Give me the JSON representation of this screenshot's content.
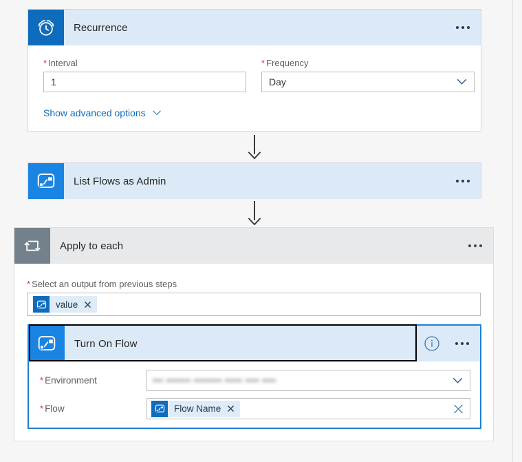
{
  "theme": {
    "accent_blue": "#0f6cbd",
    "icon_blue": "#1a84e3",
    "header_blue": "#dceaf7",
    "header_gray": "#e8e9ea",
    "icon_gray": "#74808c",
    "selected_border": "#1c7fd6",
    "required_red": "#d13438",
    "page_background": "#f6f6f6"
  },
  "steps": {
    "recurrence": {
      "title": "Recurrence",
      "icon": "alarm-clock-icon",
      "menu": "ellipsis-icon",
      "interval": {
        "label": "Interval",
        "required": true,
        "value": "1"
      },
      "frequency": {
        "label": "Frequency",
        "required": true,
        "value": "Day",
        "chevron": "chevron-down-icon"
      },
      "advanced_link": {
        "label": "Show advanced options",
        "chevron": "chevron-down-icon"
      }
    },
    "list_flows": {
      "title": "List Flows as Admin",
      "icon": "power-automate-flow-icon",
      "menu": "ellipsis-icon"
    },
    "apply_to_each": {
      "title": "Apply to each",
      "icon": "loop-repeat-icon",
      "menu": "ellipsis-icon",
      "output_field": {
        "label": "Select an output from previous steps",
        "required": true,
        "token": {
          "label": "value",
          "icon": "power-automate-flow-icon",
          "remove": "token-remove-icon"
        }
      }
    },
    "turn_on_flow": {
      "title": "Turn On Flow",
      "icon": "power-automate-flow-icon",
      "info": "info-circle-icon",
      "menu": "ellipsis-icon",
      "selected": true,
      "environment": {
        "label": "Environment",
        "required": true,
        "value": "••• ••••••• •••••••• ••••• •••• ••••",
        "redacted": true,
        "chevron": "chevron-down-icon"
      },
      "flow": {
        "label": "Flow",
        "required": true,
        "token": {
          "label": "Flow Name",
          "icon": "power-automate-flow-icon",
          "remove": "token-remove-icon"
        },
        "clear": "clear-x-icon"
      }
    }
  },
  "connectors": [
    {
      "name": "recurrence-to-list-flows",
      "arrow": "arrow-down-icon"
    },
    {
      "name": "list-flows-to-apply-to-each",
      "arrow": "arrow-down-icon"
    }
  ]
}
